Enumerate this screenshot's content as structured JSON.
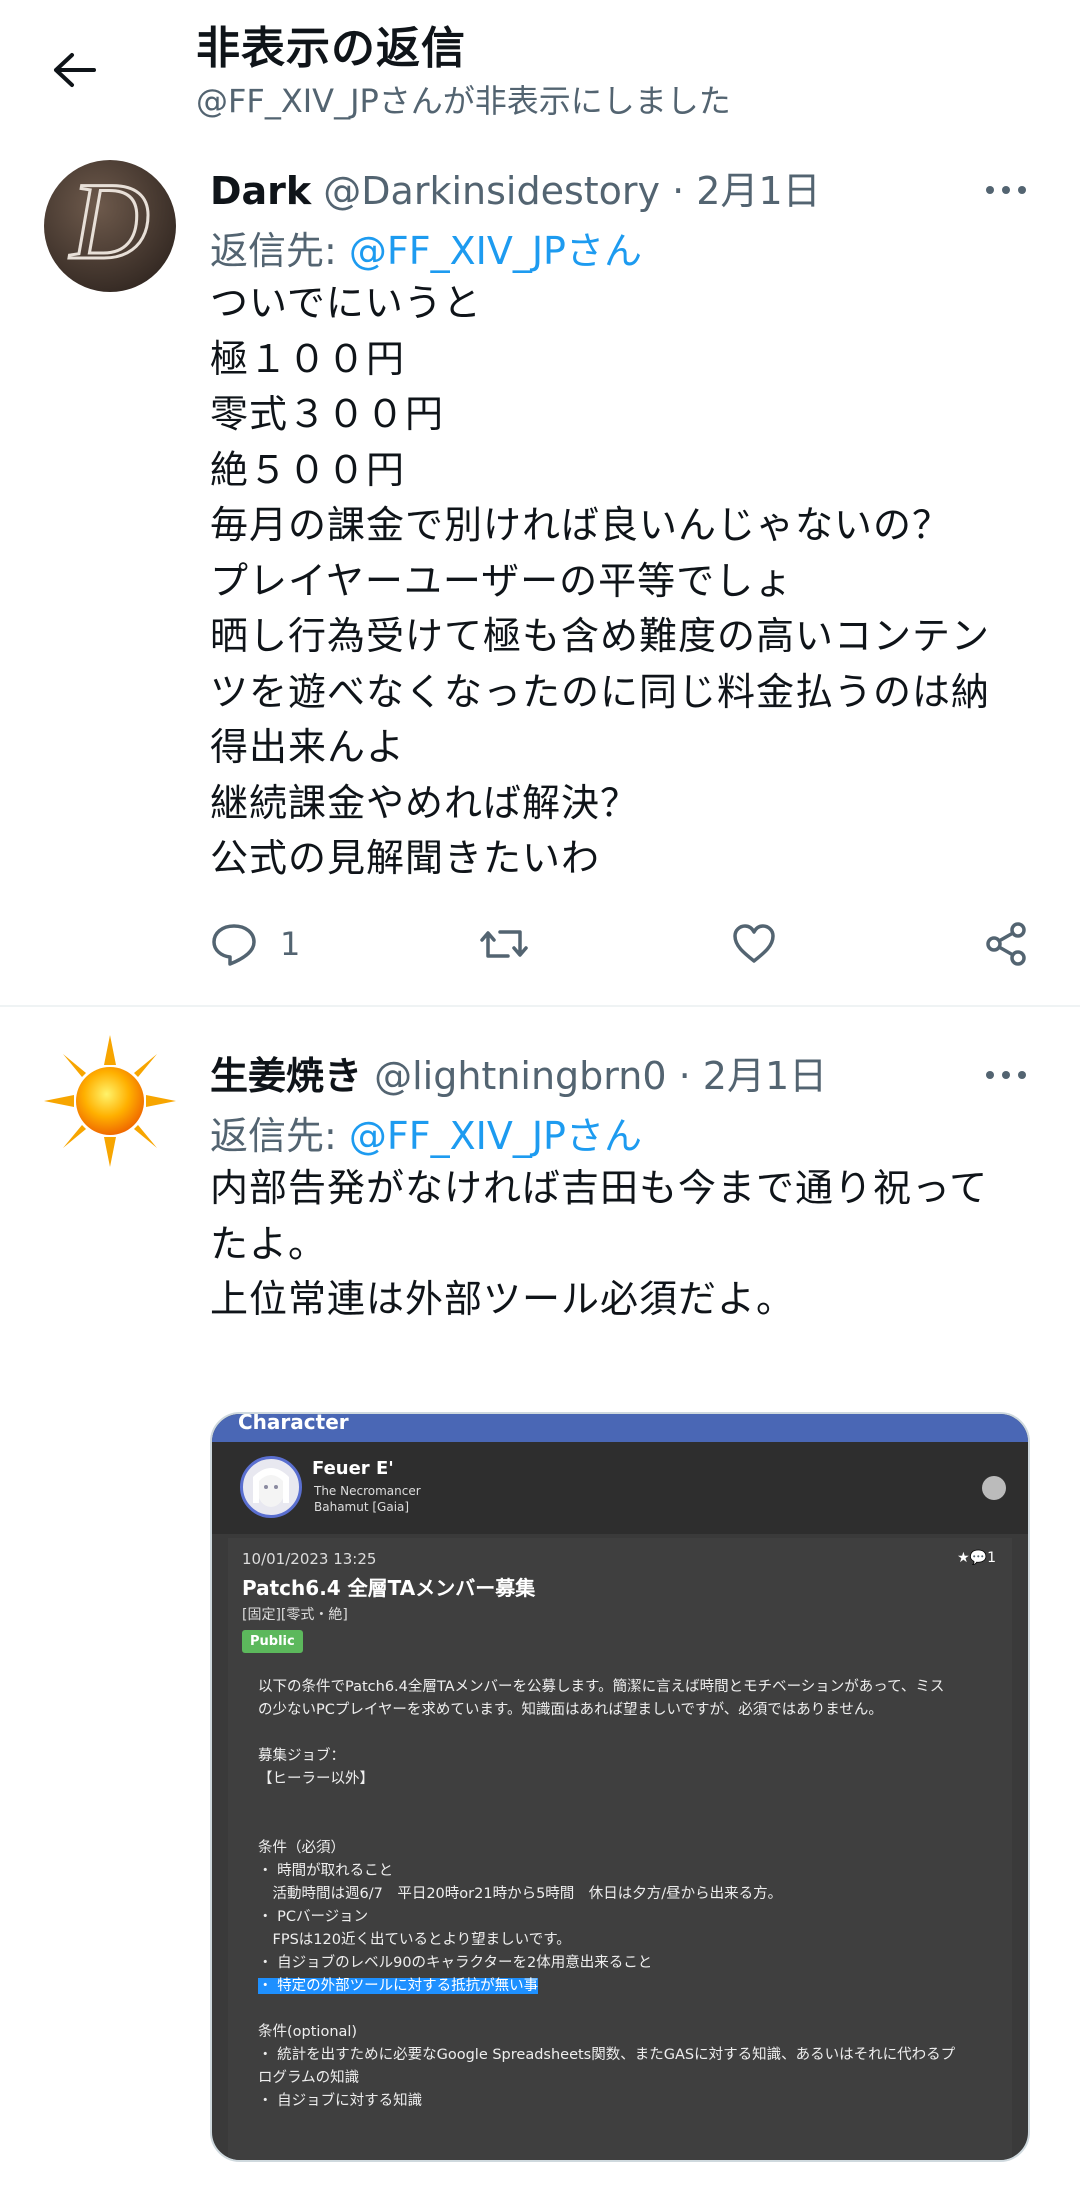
{
  "header": {
    "title": "非表示の返信",
    "subtitle": "@FF_XIV_JPさんが非表示にしました"
  },
  "tweets": [
    {
      "name": "Dark",
      "handle": "@Darkinsidestory",
      "date": "· 2月1日",
      "reply_prefix": "返信先: ",
      "reply_handle": "@FF_XIV_JP",
      "reply_suffix": "さん",
      "text": "ついでにいうと\n極１００円\n零式３００円\n絶５００円\n毎月の課金で別ければ良いんじゃないの？\nプレイヤーユーザーの平等でしょ\n晒し行為受けて極も含め難度の高いコンテン\nツを遊べなくなったのに同じ料金払うのは納\n得出来んよ\n継続課金やめれば解決？\n公式の見解聞きたいわ",
      "reply_count": "1"
    },
    {
      "name": "生姜焼き",
      "handle": "@lightningbrn0",
      "date": "· 2月1日",
      "reply_prefix": "返信先: ",
      "reply_handle": "@FF_XIV_JP",
      "reply_suffix": "さん",
      "text": "内部告発がなければ吉田も今まで通り祝って\nたよ。\n上位常連は外部ツール必須だよ。"
    }
  ],
  "media": {
    "topbar_title": "Character",
    "profile_name": "Feuer E'",
    "profile_title": "The Necromancer",
    "profile_server": "Bahamut [Gaia]",
    "post_date": "10/01/2023 13:25",
    "post_stats": "★💬1",
    "post_title": "Patch6.4 全層TAメンバー募集",
    "post_tags": "[固定][零式・絶]",
    "public_badge": "Public",
    "post_text": "以下の条件でPatch6.4全層TAメンバーを公募します。簡潔に言えば時間とモチベーションがあって、ミス\nの少ないPCプレイヤーを求めています。知識面はあれば望ましいですが、必須ではありません。\n\n募集ジョブ：\n【ヒーラー以外】\n\n\n条件（必須）\n・ 時間が取れること\n　活動時間は週6/7　平日20時or21時から5時間　休日は夕方/昼から出来る方。\n・ PCバージョン\n　FPSは120近く出ているとより望ましいです。\n・ 自ジョブのレベル90のキャラクターを2体用意出来ること",
    "post_highlight": "・ 特定の外部ツールに対する抵抗が無い事",
    "post_text2": "条件(optional)\n・ 統計を出すために必要なGoogle Spreadsheets関数、またGASに対する知識、あるいはそれに代わるプ\nログラムの知識\n・ 自ジョブに対する知識"
  },
  "colors": {
    "accent": "#1d9bf0",
    "secondary_text": "#536471",
    "primary_text": "#0f1419"
  },
  "icons": [
    "back-arrow-icon",
    "more-icon",
    "reply-icon",
    "retweet-icon",
    "like-icon",
    "share-icon"
  ]
}
